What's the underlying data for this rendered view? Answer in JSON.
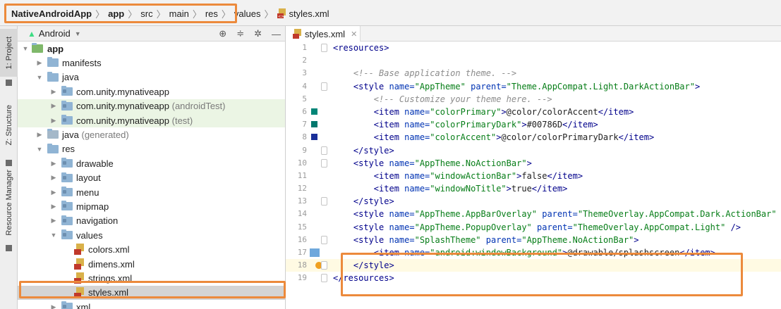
{
  "breadcrumb": {
    "items": [
      "NativeAndroidApp",
      "app",
      "src",
      "main",
      "res",
      "values",
      "styles.xml"
    ]
  },
  "strip": {
    "project_tab": "1: Project",
    "structure_tab": "Z: Structure",
    "resource_tab": "Resource Manager"
  },
  "project_panel": {
    "view_label": "Android",
    "tree": {
      "app": "app",
      "manifests": "manifests",
      "java": "java",
      "pkg1": "com.unity.mynativeapp",
      "pkg2": "com.unity.mynativeapp",
      "pkg2_suffix": "(androidTest)",
      "pkg3": "com.unity.mynativeapp",
      "pkg3_suffix": "(test)",
      "java_generated": "java",
      "java_generated_suffix": "(generated)",
      "res": "res",
      "drawable": "drawable",
      "layout": "layout",
      "menu": "menu",
      "mipmap": "mipmap",
      "navigation": "navigation",
      "values": "values",
      "colors": "colors.xml",
      "dimens": "dimens.xml",
      "strings": "strings.xml",
      "styles": "styles.xml",
      "xml": "xml"
    }
  },
  "editor": {
    "tab_label": "styles.xml",
    "line_numbers": [
      "1",
      "2",
      "3",
      "4",
      "5",
      "6",
      "7",
      "8",
      "9",
      "10",
      "11",
      "12",
      "13",
      "14",
      "15",
      "16",
      "17",
      "18",
      "19"
    ],
    "colors": {
      "accent": "#008577",
      "dark": "#00786D",
      "primary_dark": "#1a2f99",
      "highlight": "#ec8a3c"
    }
  }
}
